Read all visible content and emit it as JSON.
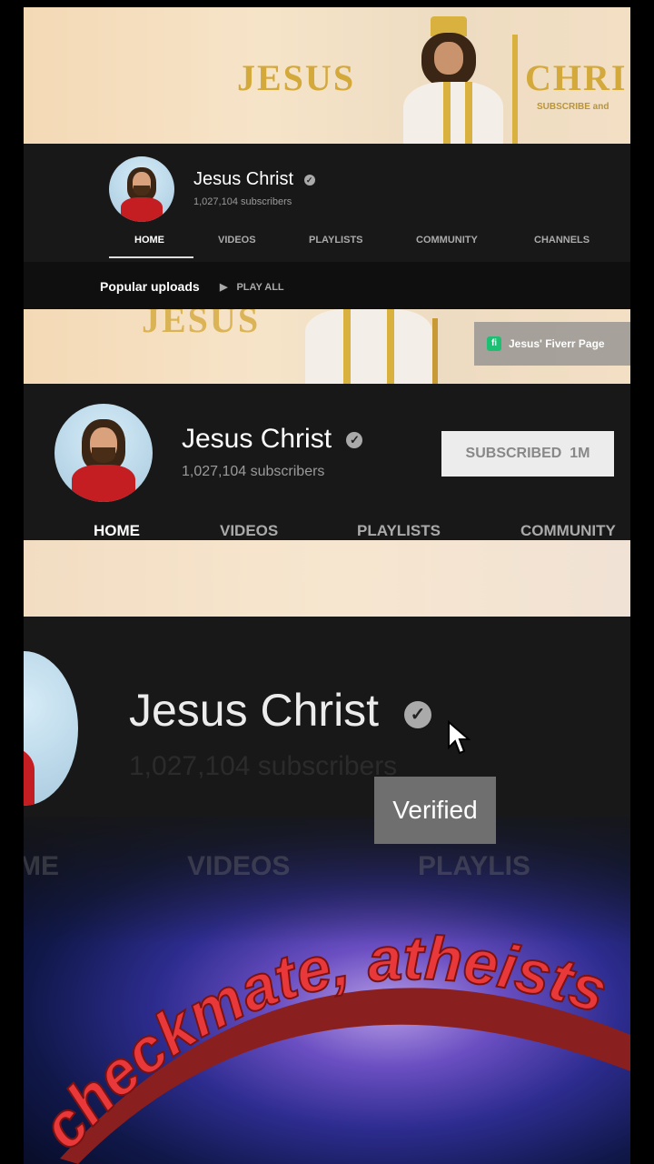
{
  "panel1": {
    "banner_title_left": "JESUS",
    "banner_title_right": "CHRI",
    "banner_small": "SUBSCRIBE and",
    "channel_name": "Jesus Christ",
    "subscribers": "1,027,104 subscribers",
    "tabs": [
      "HOME",
      "VIDEOS",
      "PLAYLISTS",
      "COMMUNITY",
      "CHANNELS"
    ],
    "section_title": "Popular uploads",
    "play_all": "PLAY ALL"
  },
  "panel2": {
    "banner_text": "JESUS",
    "link_label": "Jesus' Fiverr Page",
    "link_icon": "fiverr-icon",
    "channel_name": "Jesus Christ",
    "subscribers": "1,027,104 subscribers",
    "subscribe_button": "SUBSCRIBED  1M",
    "tabs": [
      "HOME",
      "VIDEOS",
      "PLAYLISTS",
      "COMMUNITY"
    ]
  },
  "panel3": {
    "channel_name": "Jesus Christ",
    "subscribers": "1,027,104 subscribers",
    "tooltip": "Verified",
    "faded_tabs": [
      "ME",
      "VIDEOS",
      "PLAYLIS"
    ],
    "caption": "checkmate, atheists"
  },
  "colors": {
    "background": "#181818",
    "accent_gold": "#d4a93b",
    "caption_red": "#e8383a"
  }
}
